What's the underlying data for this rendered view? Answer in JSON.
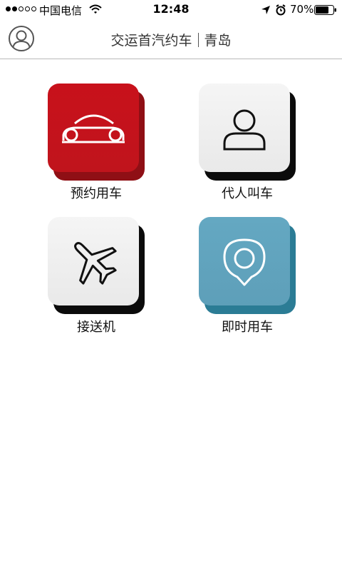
{
  "status_bar": {
    "carrier": "中国电信",
    "time": "12:48",
    "battery": "70%",
    "signal_bars": 2,
    "icons": [
      "wifi-icon",
      "location-icon",
      "alarm-icon",
      "battery-icon"
    ]
  },
  "nav": {
    "title": "交运首汽约车",
    "city": "青岛",
    "left_icon": "user-avatar-icon"
  },
  "tiles": [
    {
      "label": "预约用车",
      "icon": "car-icon",
      "color": "#c8111b"
    },
    {
      "label": "代人叫车",
      "icon": "person-icon",
      "color": "#f0f0f0"
    },
    {
      "label": "接送机",
      "icon": "airplane-icon",
      "color": "#f0f0f0"
    },
    {
      "label": "即时用车",
      "icon": "location-pin-icon",
      "color": "#62a6c0"
    }
  ]
}
